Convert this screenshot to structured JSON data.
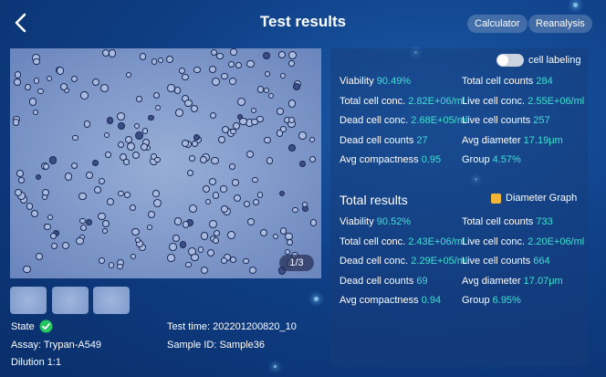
{
  "header": {
    "title": "Test results",
    "calculator_label": "Calculator",
    "reanalysis_label": "Reanalysis"
  },
  "image": {
    "page_indicator": "1/3"
  },
  "info": {
    "state_label": "State",
    "assay": "Assay: Trypan-A549",
    "dilution": "Dilution 1:1",
    "test_time": "Test time: 202201200820_10",
    "sample_id": "Sample ID: Sample36"
  },
  "image_results": {
    "cell_labeling_label": "cell labeling",
    "rows": [
      {
        "l1": "Viability",
        "v1": "90.49%",
        "l2": "Total cell counts",
        "v2": "284"
      },
      {
        "l1": "Total cell conc.",
        "v1": "2.82E+06/ml",
        "l2": "Live cell conc.",
        "v2": "2.55E+06/ml"
      },
      {
        "l1": "Dead cell conc.",
        "v1": "2.68E+05/ml",
        "l2": "Live cell counts",
        "v2": "257"
      },
      {
        "l1": "Dead cell counts",
        "v1": "27",
        "l2": "Avg diameter",
        "v2": "17.19μm"
      },
      {
        "l1": "Avg compactness",
        "v1": "0.95",
        "l2": "Group",
        "v2": "4.57%"
      }
    ]
  },
  "total_results": {
    "title": "Total results",
    "diameter_graph_label": "Diameter Graph",
    "rows": [
      {
        "l1": "Viability",
        "v1": "90.52%",
        "l2": "Total cell counts",
        "v2": "733"
      },
      {
        "l1": "Total cell conc.",
        "v1": "2.43E+06/ml",
        "l2": "Live cell conc.",
        "v2": "2.20E+06/ml"
      },
      {
        "l1": "Dead cell conc.",
        "v1": "2.29E+05/ml",
        "l2": "Live cell counts",
        "v2": "664"
      },
      {
        "l1": "Dead cell counts",
        "v1": "69",
        "l2": "Avg diameter",
        "v2": "17.07μm"
      },
      {
        "l1": "Avg compactness",
        "v1": "0.94",
        "l2": "Group",
        "v2": "6.95%"
      }
    ]
  },
  "colors": {
    "accent_value": "#3fe0d2",
    "state_ok": "#22c55e",
    "graph_icon": "#f2b53a"
  }
}
